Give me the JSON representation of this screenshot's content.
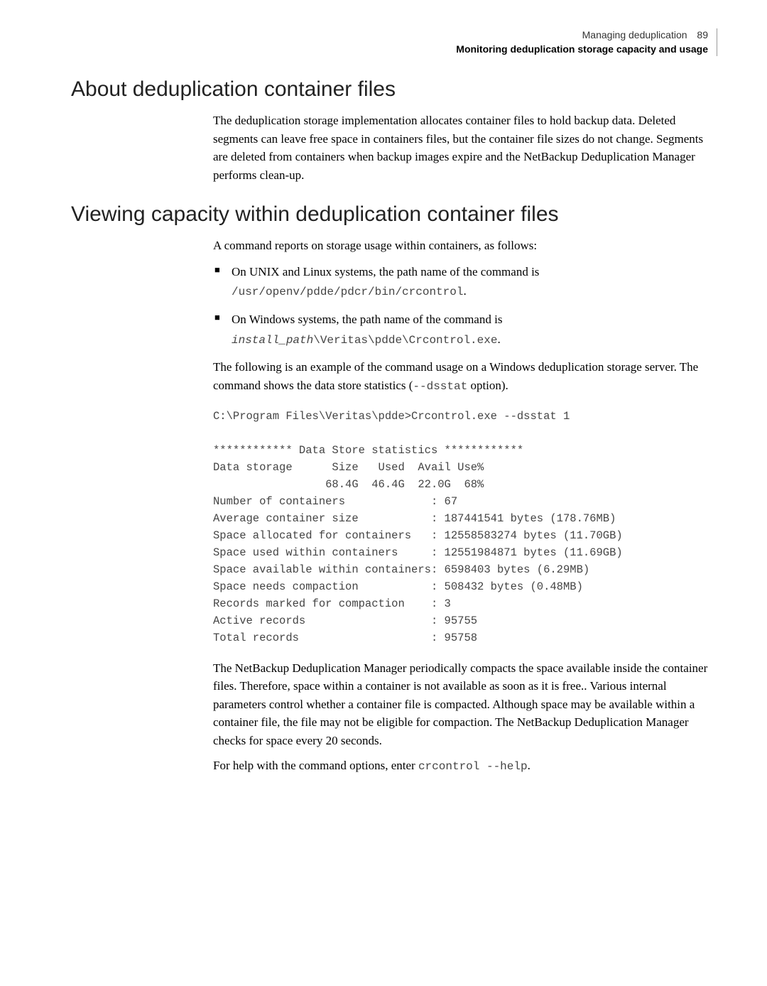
{
  "header": {
    "chapter": "Managing deduplication",
    "page": "89",
    "subtitle": "Monitoring deduplication storage capacity and usage"
  },
  "section1": {
    "title": "About deduplication container files",
    "para1": "The deduplication storage implementation allocates container files to hold backup data. Deleted segments can leave free space in containers files, but the container file sizes do not change. Segments are deleted from containers when backup images expire and the NetBackup Deduplication Manager performs clean-up."
  },
  "section2": {
    "title": "Viewing capacity within deduplication container files",
    "para1": "A command reports on storage usage within containers, as follows:",
    "bullet1_text": "On UNIX and Linux systems, the path name of the command is",
    "bullet1_code": "/usr/openv/pdde/pdcr/bin/crcontrol",
    "bullet1_dot": ".",
    "bullet2_text": "On Windows systems, the path name of the command is",
    "bullet2_code_italic": "install_path",
    "bullet2_code_rest": "\\Veritas\\pdde\\Crcontrol.exe",
    "bullet2_dot": ".",
    "para2_a": "The following is an example of the command usage on a Windows deduplication storage server. The command shows the data store statistics (",
    "para2_code": "--dsstat",
    "para2_b": " option).",
    "codeblock": "C:\\Program Files\\Veritas\\pdde>Crcontrol.exe --dsstat 1\n\n************ Data Store statistics ************\nData storage      Size   Used  Avail Use%\n                 68.4G  46.4G  22.0G  68%\nNumber of containers             : 67\nAverage container size           : 187441541 bytes (178.76MB)\nSpace allocated for containers   : 12558583274 bytes (11.70GB)\nSpace used within containers     : 12551984871 bytes (11.69GB)\nSpace available within containers: 6598403 bytes (6.29MB)\nSpace needs compaction           : 508432 bytes (0.48MB)\nRecords marked for compaction    : 3\nActive records                   : 95755\nTotal records                    : 95758",
    "para3": "The NetBackup Deduplication Manager periodically compacts the space available inside the container files. Therefore, space within a container is not available as soon as it is free.. Various internal parameters control whether a container file is compacted. Although space may be available within a container file, the file may not be eligible for compaction. The NetBackup Deduplication Manager checks for space every 20 seconds.",
    "para4_a": "For help with the command options, enter ",
    "para4_code": "crcontrol --help",
    "para4_b": "."
  }
}
